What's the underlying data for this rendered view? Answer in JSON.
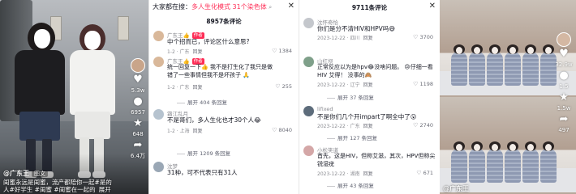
{
  "panel1": {
    "author": "@广东王",
    "author_tag": "图文",
    "caption_line1": "闺蜜永远是闺蜜，流产都陪你一起#是的",
    "caption_line2": "人#好学生 #闺蜜 #闺蜜在一起的",
    "caption_more": "展开",
    "sidebar": {
      "like_count": "5.3w",
      "comment_count": "6957",
      "fav_count": "648",
      "share_count": "6.4万"
    }
  },
  "panel2": {
    "header_prefix": "大家都在搜：",
    "header_keyword": "多人生化模式 31个染色体",
    "header_search_icon": "search-icon",
    "comment_count": "8957条评论",
    "comments": [
      {
        "user": "广东王",
        "user_mark": "👍",
        "badge": "作者",
        "text": "中个招而已，评论区什么意思?",
        "meta": "1-2 · 广东",
        "reply": "回复",
        "likes": "1384"
      },
      {
        "user": "广东王",
        "user_mark": "👍",
        "badge": "作者",
        "text_line1": "统一回复一下👍 我不是打生化了我只是做",
        "text_line2": "错了一些事情但我不是坏孩子 🙏",
        "meta": "1-2 · 广东",
        "reply": "回复",
        "likes": "255"
      },
      {
        "expand": "展开 404 条回复"
      },
      {
        "user": "霜江乱月",
        "text": "不是哥们，多人生化也才30个人😂",
        "meta": "1-2 · 上海",
        "reply": "回复",
        "likes": "8040",
        "expand": "展开 1209 条回复"
      },
      {
        "user": "沈梦",
        "text": "31种，可不代表只有31人",
        "meta": ""
      }
    ]
  },
  "panel3": {
    "comment_count": "9711条评论",
    "comments": [
      {
        "user": "沈怀奇恰",
        "text": "你们是分不清HIV和HPV吗😅",
        "meta": "2023-12-22 · 四川",
        "reply": "回复",
        "likes": "3700"
      },
      {
        "user": "山红坝",
        "text_line1": "正常反应以为是hpv😂没啥问题。 😢仔细一看",
        "text_line2": "HIV 艾得！ 没事的🙈",
        "meta": "2023-12-22 · 辽宁",
        "reply": "回复",
        "likes": "1198",
        "expand": "展开 37 条回复"
      },
      {
        "user": "lifixed",
        "text": "不是你们几个开impart了啊全中了😮",
        "meta": "2023-12-22 · 广东",
        "reply": "回复",
        "likes": "2740",
        "expand": "展开 127 条回复"
      },
      {
        "user": "小松笑道",
        "text_line1": "首先，这是HIV，但称艾滋，其次，HPV但称尖",
        "text_line2": "锐湿疣",
        "meta": "2023-12-22 · 湖南",
        "reply": "回复",
        "likes": "671",
        "expand": "展开 43 条回复"
      }
    ]
  },
  "panel4": {
    "author": "@广东王",
    "sidebar": {
      "like_count": "32.9w",
      "comment_count": "1.5",
      "fav_count": "1.5w",
      "share_count": "497"
    }
  },
  "colors": {
    "accent": "#fe2c55",
    "muted_text": "#8a8b91",
    "main_text": "#161823"
  }
}
